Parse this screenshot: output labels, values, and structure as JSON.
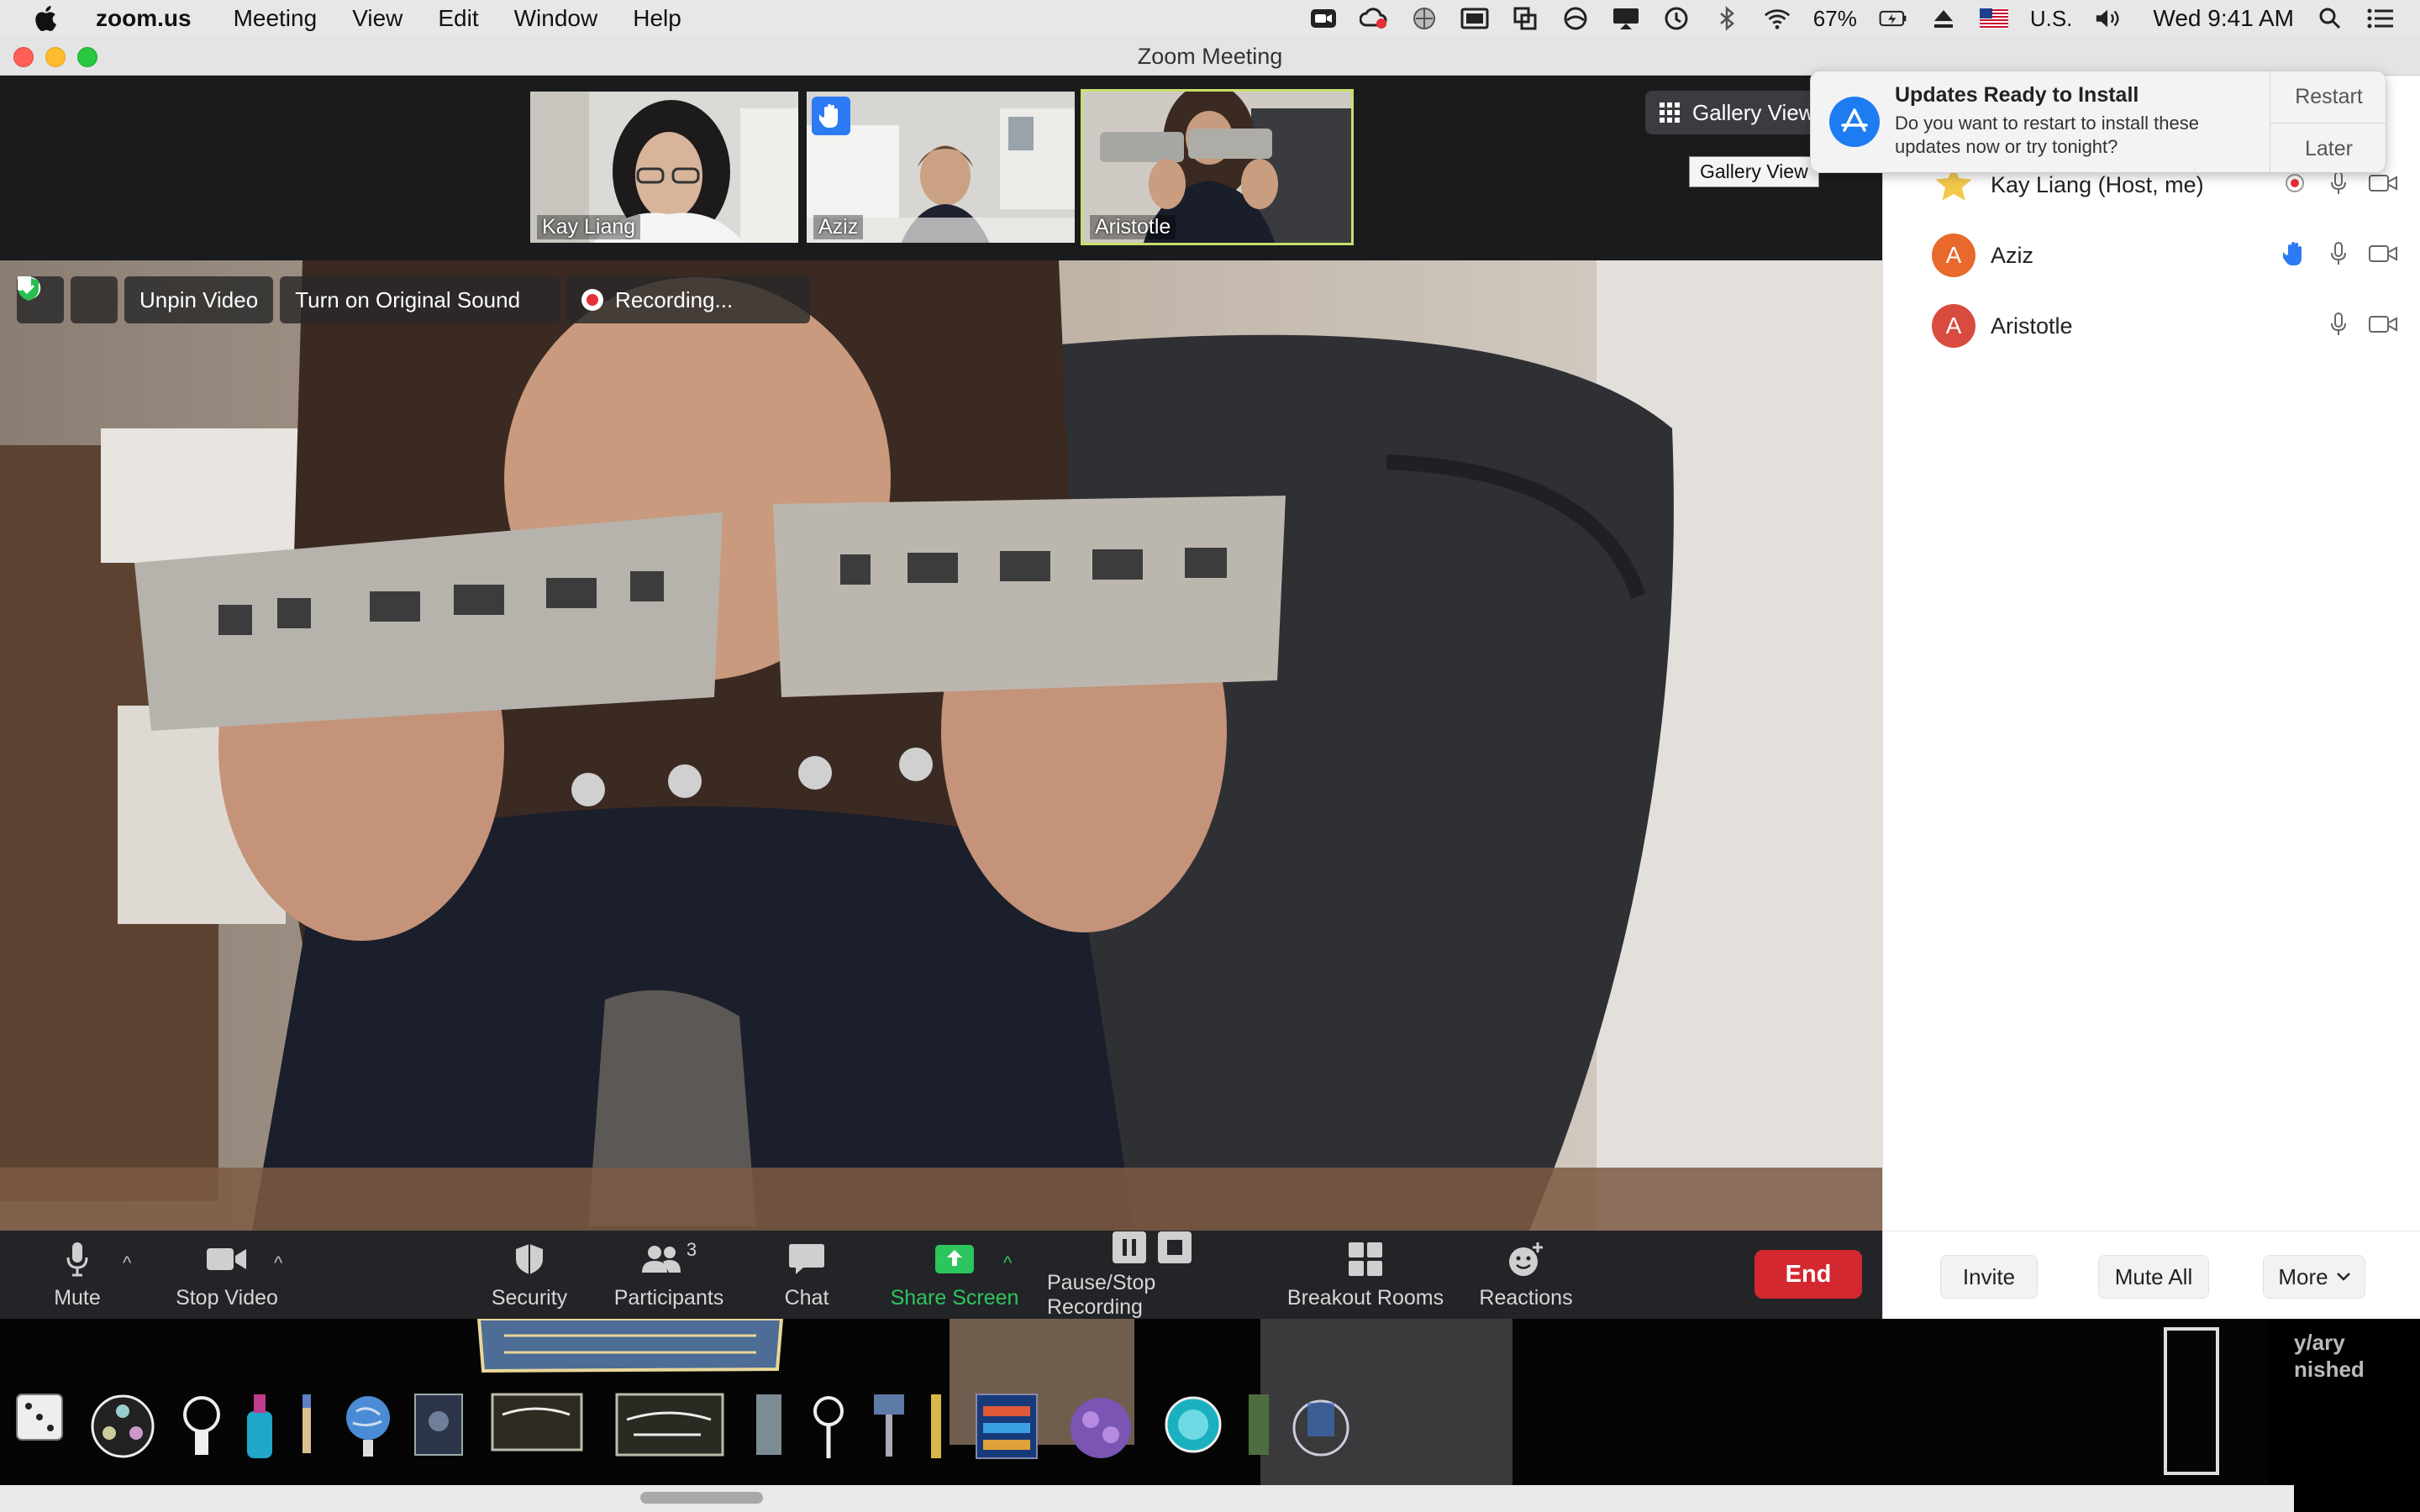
{
  "menubar": {
    "app_name": "zoom.us",
    "menus": [
      "Meeting",
      "View",
      "Edit",
      "Window",
      "Help"
    ],
    "battery": "67%",
    "input_source": "U.S.",
    "clock": "Wed 9:41 AM",
    "tray_icons": [
      "zoom-camera-icon",
      "creative-cloud-icon",
      "ball-icon",
      "screen-icon",
      "copy-icon",
      "circle-icon",
      "display-icon",
      "time-machine-icon",
      "bluetooth-icon",
      "wifi-icon",
      "battery-icon",
      "eject-icon",
      "flag-icon",
      "volume-icon",
      "spotlight-icon",
      "notification-center-icon"
    ]
  },
  "window": {
    "title": "Zoom Meeting"
  },
  "thumbnails": [
    {
      "name": "Kay Liang",
      "active": false,
      "raised_hand": false
    },
    {
      "name": "Aziz",
      "active": false,
      "raised_hand": true
    },
    {
      "name": "Aristotle",
      "active": true,
      "raised_hand": false
    }
  ],
  "gallery": {
    "button_label": "Gallery View",
    "tooltip": "Gallery View"
  },
  "video_tools": {
    "unpin": "Unpin Video",
    "original_sound": "Turn on Original Sound",
    "recording": "Recording..."
  },
  "toolbar": {
    "mute": "Mute",
    "stop_video": "Stop Video",
    "security": "Security",
    "participants": "Participants",
    "participants_count": "3",
    "chat": "Chat",
    "share_screen": "Share Screen",
    "pause_stop_recording": "Pause/Stop Recording",
    "breakout_rooms": "Breakout Rooms",
    "reactions": "Reactions",
    "end": "End"
  },
  "participants": [
    {
      "name": "Kay Liang (Host, me)",
      "avatar": "star-icon",
      "recording": true,
      "hand": false
    },
    {
      "name": "Aziz",
      "avatar": "A",
      "avatar_color": "#e8692b",
      "recording": false,
      "hand": true
    },
    {
      "name": "Aristotle",
      "avatar": "A",
      "avatar_color": "#d94b3f",
      "recording": false,
      "hand": false
    }
  ],
  "panel_footer": {
    "invite": "Invite",
    "mute_all": "Mute All",
    "more": "More"
  },
  "notification": {
    "title": "Updates Ready to Install",
    "body": "Do you want to restart to install these updates now or try tonight?",
    "restart": "Restart",
    "later": "Later"
  },
  "desktop": {
    "partial_text_1": "y/ary",
    "partial_text_2": "nished"
  },
  "colors": {
    "accent_green": "#2dc55e",
    "end_red": "#d3282f",
    "raise_hand_blue": "#2d7af5",
    "active_border": "#c8e06a"
  }
}
